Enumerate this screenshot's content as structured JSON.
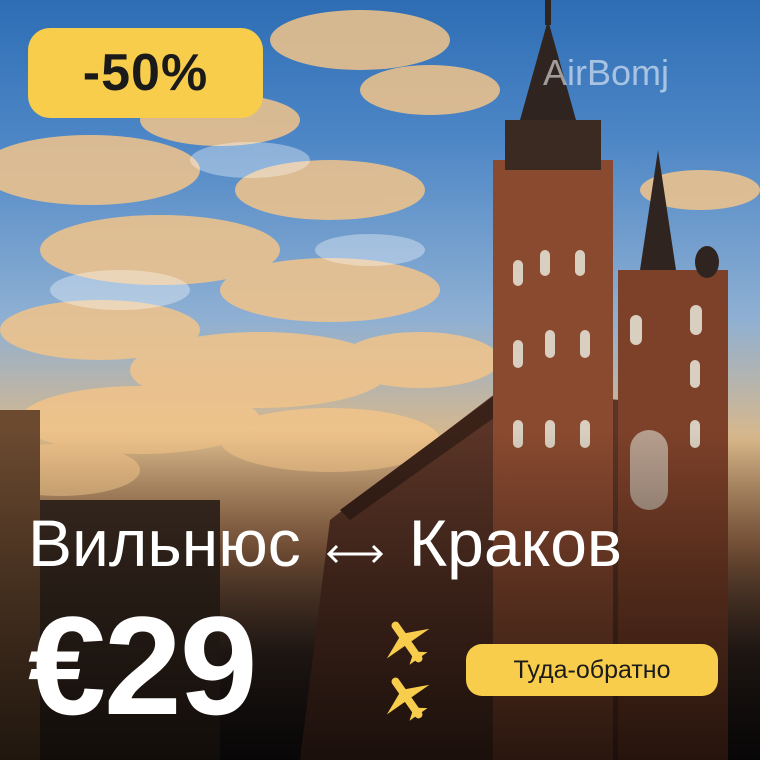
{
  "badge": {
    "text": "-50%"
  },
  "brand": {
    "name": "AirBomj"
  },
  "route": {
    "from": "Вильнюс",
    "to": "Краков",
    "arrow_icon": "double-arrow-icon"
  },
  "price": {
    "value": "€29"
  },
  "trip_type": {
    "label": "Туда-обратно"
  },
  "colors": {
    "accent": "#f8cd4b",
    "text": "#ffffff"
  }
}
